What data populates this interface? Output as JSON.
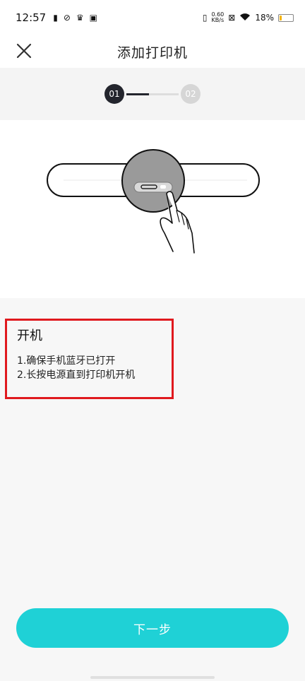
{
  "status_bar": {
    "time": "12:57",
    "net_speed_value": "0.60",
    "net_speed_unit": "KB/s",
    "battery_text": "18%",
    "battery_level": 0.18,
    "battery_color": "#f5b400"
  },
  "nav": {
    "title": "添加打印机",
    "close_icon": "close-icon"
  },
  "stepper": {
    "steps": [
      "01",
      "02"
    ],
    "current_step": 1,
    "active_color": "#23252d",
    "inactive_color": "#d6d6d6"
  },
  "instructions": {
    "title": "开机",
    "lines": [
      "1.确保手机蓝牙已打开",
      "2.长按电源直到打印机开机"
    ],
    "highlight_color": "#e0191e"
  },
  "footer": {
    "next_label": "下一步",
    "button_color": "#1fd1d6"
  }
}
